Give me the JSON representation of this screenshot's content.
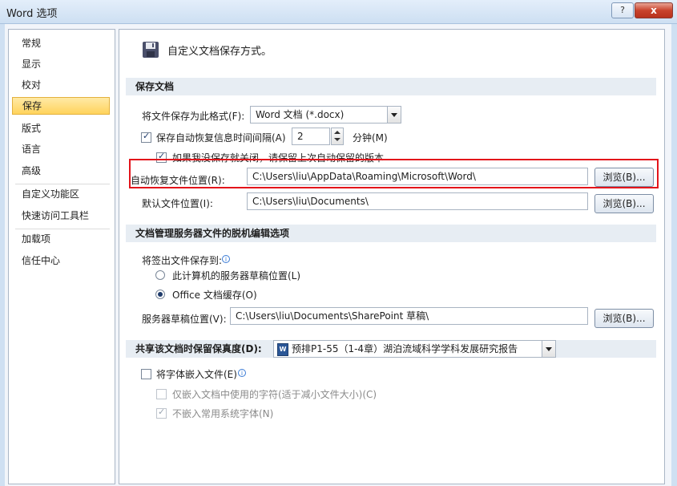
{
  "window": {
    "title": "Word 选项",
    "help_glyph": "?",
    "close_glyph": "x"
  },
  "nav": {
    "items": [
      {
        "label": "常规"
      },
      {
        "label": "显示"
      },
      {
        "label": "校对"
      },
      {
        "label": "保存",
        "selected": true
      },
      {
        "label": "版式"
      },
      {
        "label": "语言"
      },
      {
        "label": "高级"
      },
      {
        "label": "自定义功能区"
      },
      {
        "label": "快速访问工具栏"
      },
      {
        "label": "加载项"
      },
      {
        "label": "信任中心"
      }
    ]
  },
  "header": {
    "icon": "floppy-disk-icon",
    "text": "自定义文档保存方式。"
  },
  "save_docs": {
    "section_title": "保存文档",
    "format_label": "将文件保存为此格式(F):",
    "format_value": "Word 文档 (*.docx)",
    "autorecover_label": "保存自动恢复信息时间间隔(A)",
    "autorecover_checked": true,
    "autorecover_minutes": "2",
    "minutes_label": "分钟(M)",
    "keep_last_label": "如果我没保存就关闭，请保留上次自动保留的版本",
    "keep_last_checked": true,
    "autorecover_path_label": "自动恢复文件位置(R):",
    "autorecover_path": "C:\\Users\\liu\\AppData\\Roaming\\Microsoft\\Word\\",
    "browse_label": "浏览(B)...",
    "default_path_label": "默认文件位置(I):",
    "default_path": "C:\\Users\\liu\\Documents\\"
  },
  "offline": {
    "section_title": "文档管理服务器文件的脱机编辑选项",
    "checkout_label": "将签出文件保存到:",
    "radio_server_label": "此计算机的服务器草稿位置(L)",
    "radio_cache_label": "Office 文档缓存(O)",
    "selected": "cache",
    "drafts_label": "服务器草稿位置(V):",
    "drafts_path": "C:\\Users\\liu\\Documents\\SharePoint 草稿\\",
    "browse_label": "浏览(B)..."
  },
  "fidelity": {
    "section_title": "共享该文档时保留保真度(D):",
    "document": "预排P1-55（1-4章）湖泊流域科学学科发展研究报告",
    "doc_icon_glyph": "W",
    "embed_fonts_label": "将字体嵌入文件(E)",
    "embed_fonts_checked": false,
    "embed_used_label": "仅嵌入文档中使用的字符(适于减小文件大小)(C)",
    "embed_used_checked": false,
    "no_common_label": "不嵌入常用系统字体(N)",
    "no_common_checked": true
  },
  "colors": {
    "highlight_box": "#e3141b",
    "selected_nav": "#ffd35c"
  }
}
